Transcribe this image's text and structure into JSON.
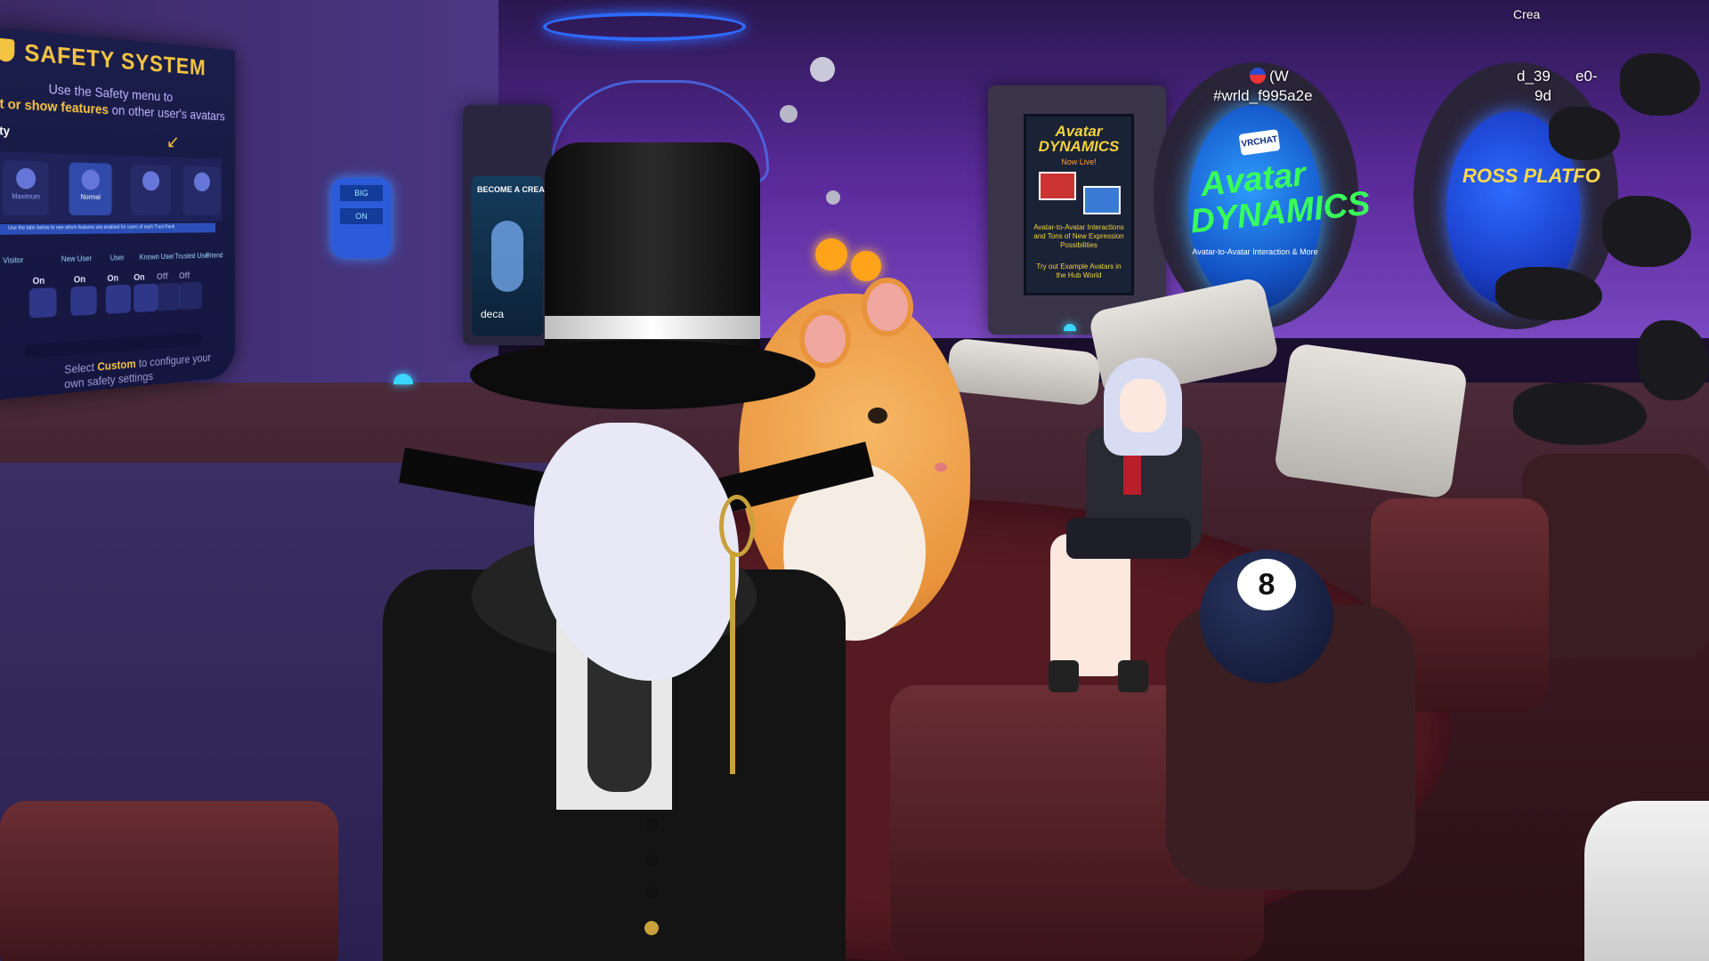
{
  "safety_system": {
    "title": "SAFETY SYSTEM",
    "line1": "Use the Safety menu to",
    "line2_pre": "t or show features",
    "line2_post": " on other user's avatars",
    "section_label": "ety",
    "tabs": [
      "Maximum",
      "Normal",
      "",
      ""
    ],
    "note": "Use the tabs below to see which features are enabled for users of each Trust Rank",
    "ranks": [
      "Visitor",
      "New User",
      "User",
      "Known User",
      "Trusted User",
      "Friend"
    ],
    "toggle_states": [
      "On",
      "On",
      "On",
      "On",
      "Off",
      "Off"
    ],
    "footer_pre": "Select ",
    "footer_emphasis": "Custom",
    "footer_post": " to configure your",
    "footer_line2": "own safety settings"
  },
  "kiosk_left": {
    "title": "BECOME A CREA",
    "caption": "deca"
  },
  "wall_button_labels": [
    "BIG",
    "ON"
  ],
  "avatar_dynamics_poster": {
    "title": "Avatar DYNAMICS",
    "subtitle": "Now Live!",
    "body": "Avatar-to-Avatar Interactions and Tons of New Expression Possibilities",
    "cta": "Try out Example Avatars in the Hub World"
  },
  "vrchat_orb": {
    "logo": "VRCHAT",
    "title": "Avatar DYNAMICS",
    "subtitle": "Avatar-to-Avatar Interaction & More"
  },
  "cross_platform_orb": {
    "title": "ROSS PLATFO"
  },
  "nameplates": [
    {
      "text": "#wrld_f995a2e"
    },
    {
      "text": "(W"
    },
    {
      "text": "d_39"
    },
    {
      "text": "e0-"
    },
    {
      "text": "9d"
    },
    {
      "text": "Crea"
    }
  ],
  "eight_ball": {
    "number": "8"
  },
  "colors": {
    "safety_gold": "#f3c343",
    "avatar_dynamics_green": "#38ff5a",
    "hub_purple": "#5b2b9c"
  }
}
